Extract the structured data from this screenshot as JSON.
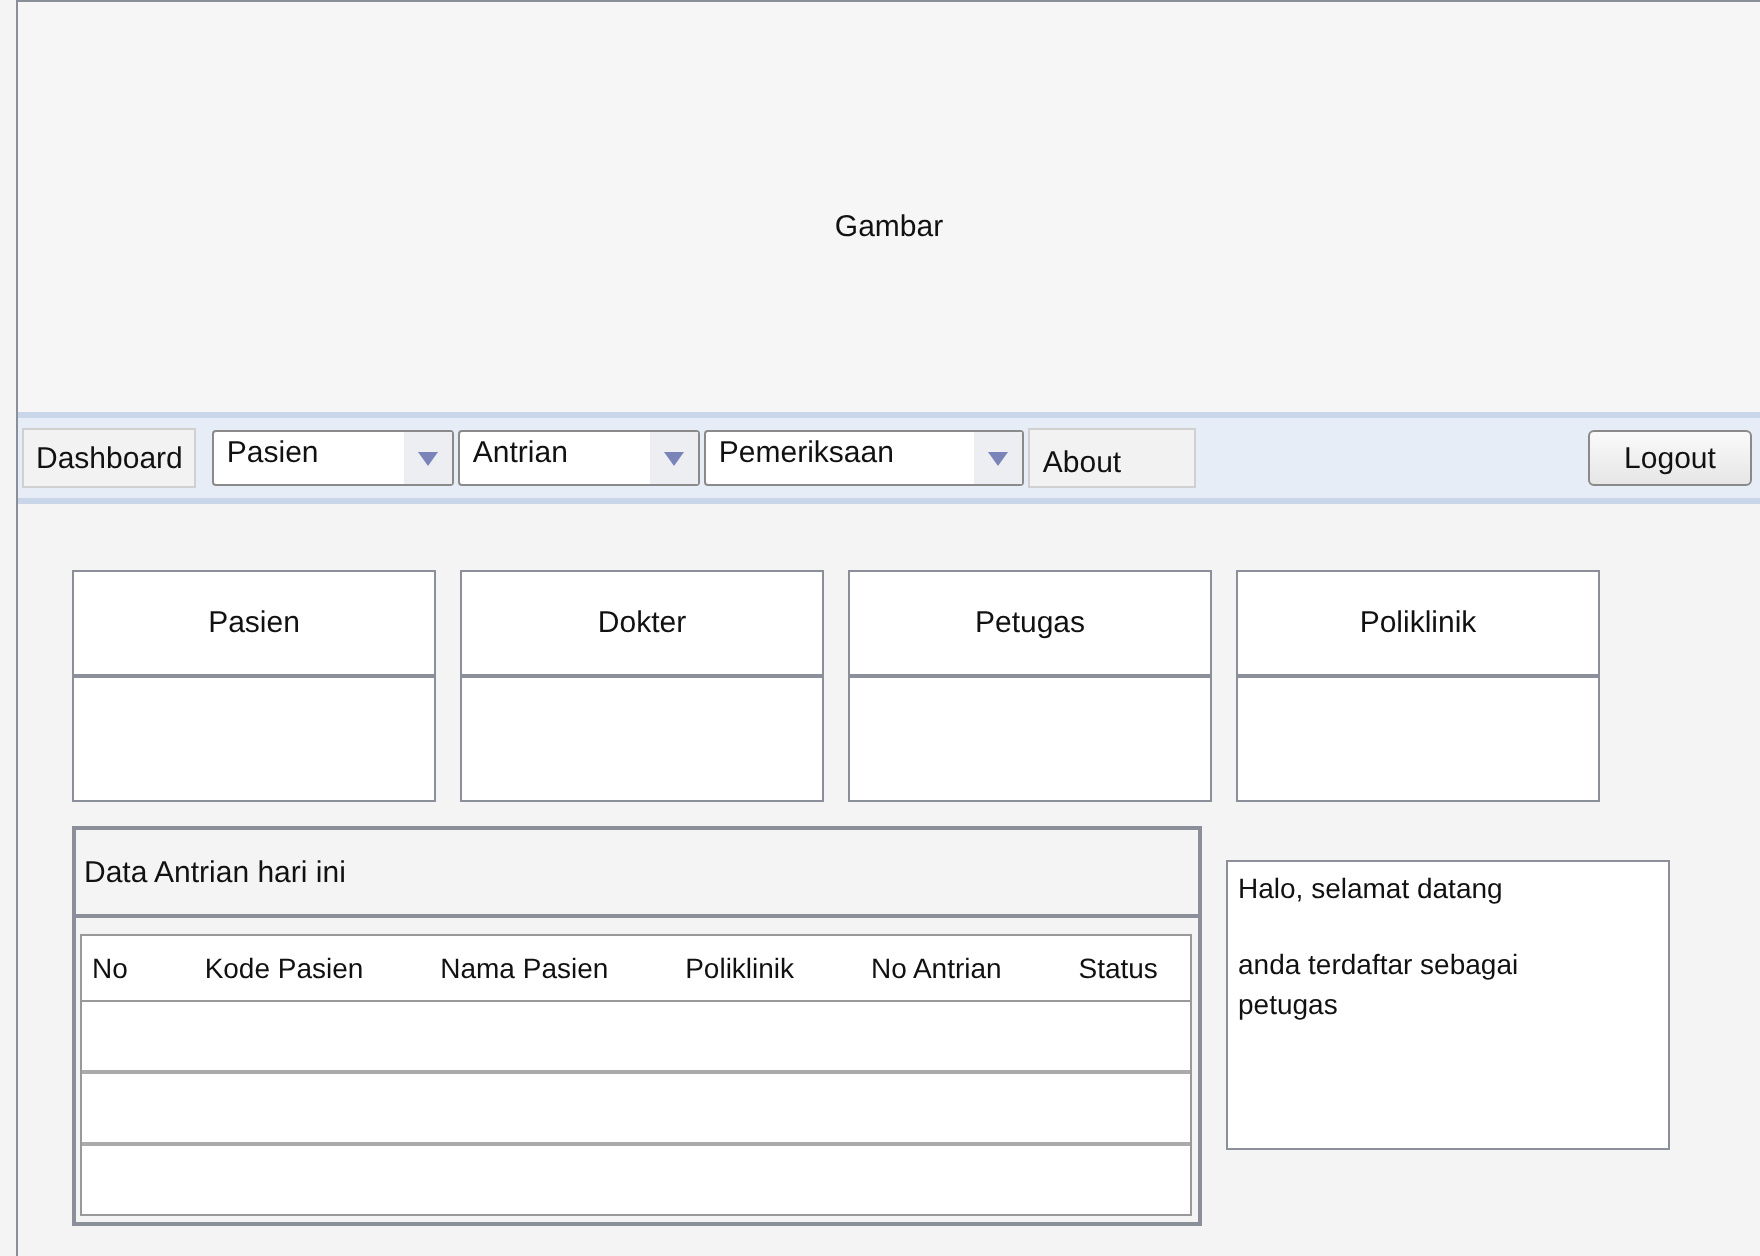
{
  "header": {
    "image_label": "Gambar"
  },
  "nav": {
    "items": [
      {
        "kind": "link",
        "label": "Dashboard"
      },
      {
        "kind": "dropdown",
        "label": "Pasien"
      },
      {
        "kind": "dropdown",
        "label": "Antrian"
      },
      {
        "kind": "dropdown",
        "label": "Pemeriksaan"
      },
      {
        "kind": "tab",
        "label": "About"
      }
    ],
    "logout": "Logout"
  },
  "cards": [
    {
      "title": "Pasien"
    },
    {
      "title": "Dokter"
    },
    {
      "title": "Petugas"
    },
    {
      "title": "Poliklinik"
    }
  ],
  "queue": {
    "title": "Data Antrian hari ini",
    "columns": [
      "No",
      "Kode Pasien",
      "Nama Pasien",
      "Poliklinik",
      "No Antrian",
      "Status"
    ]
  },
  "message": {
    "lines": [
      "Halo, selamat datang",
      "anda terdaftar sebagai petugas"
    ]
  }
}
